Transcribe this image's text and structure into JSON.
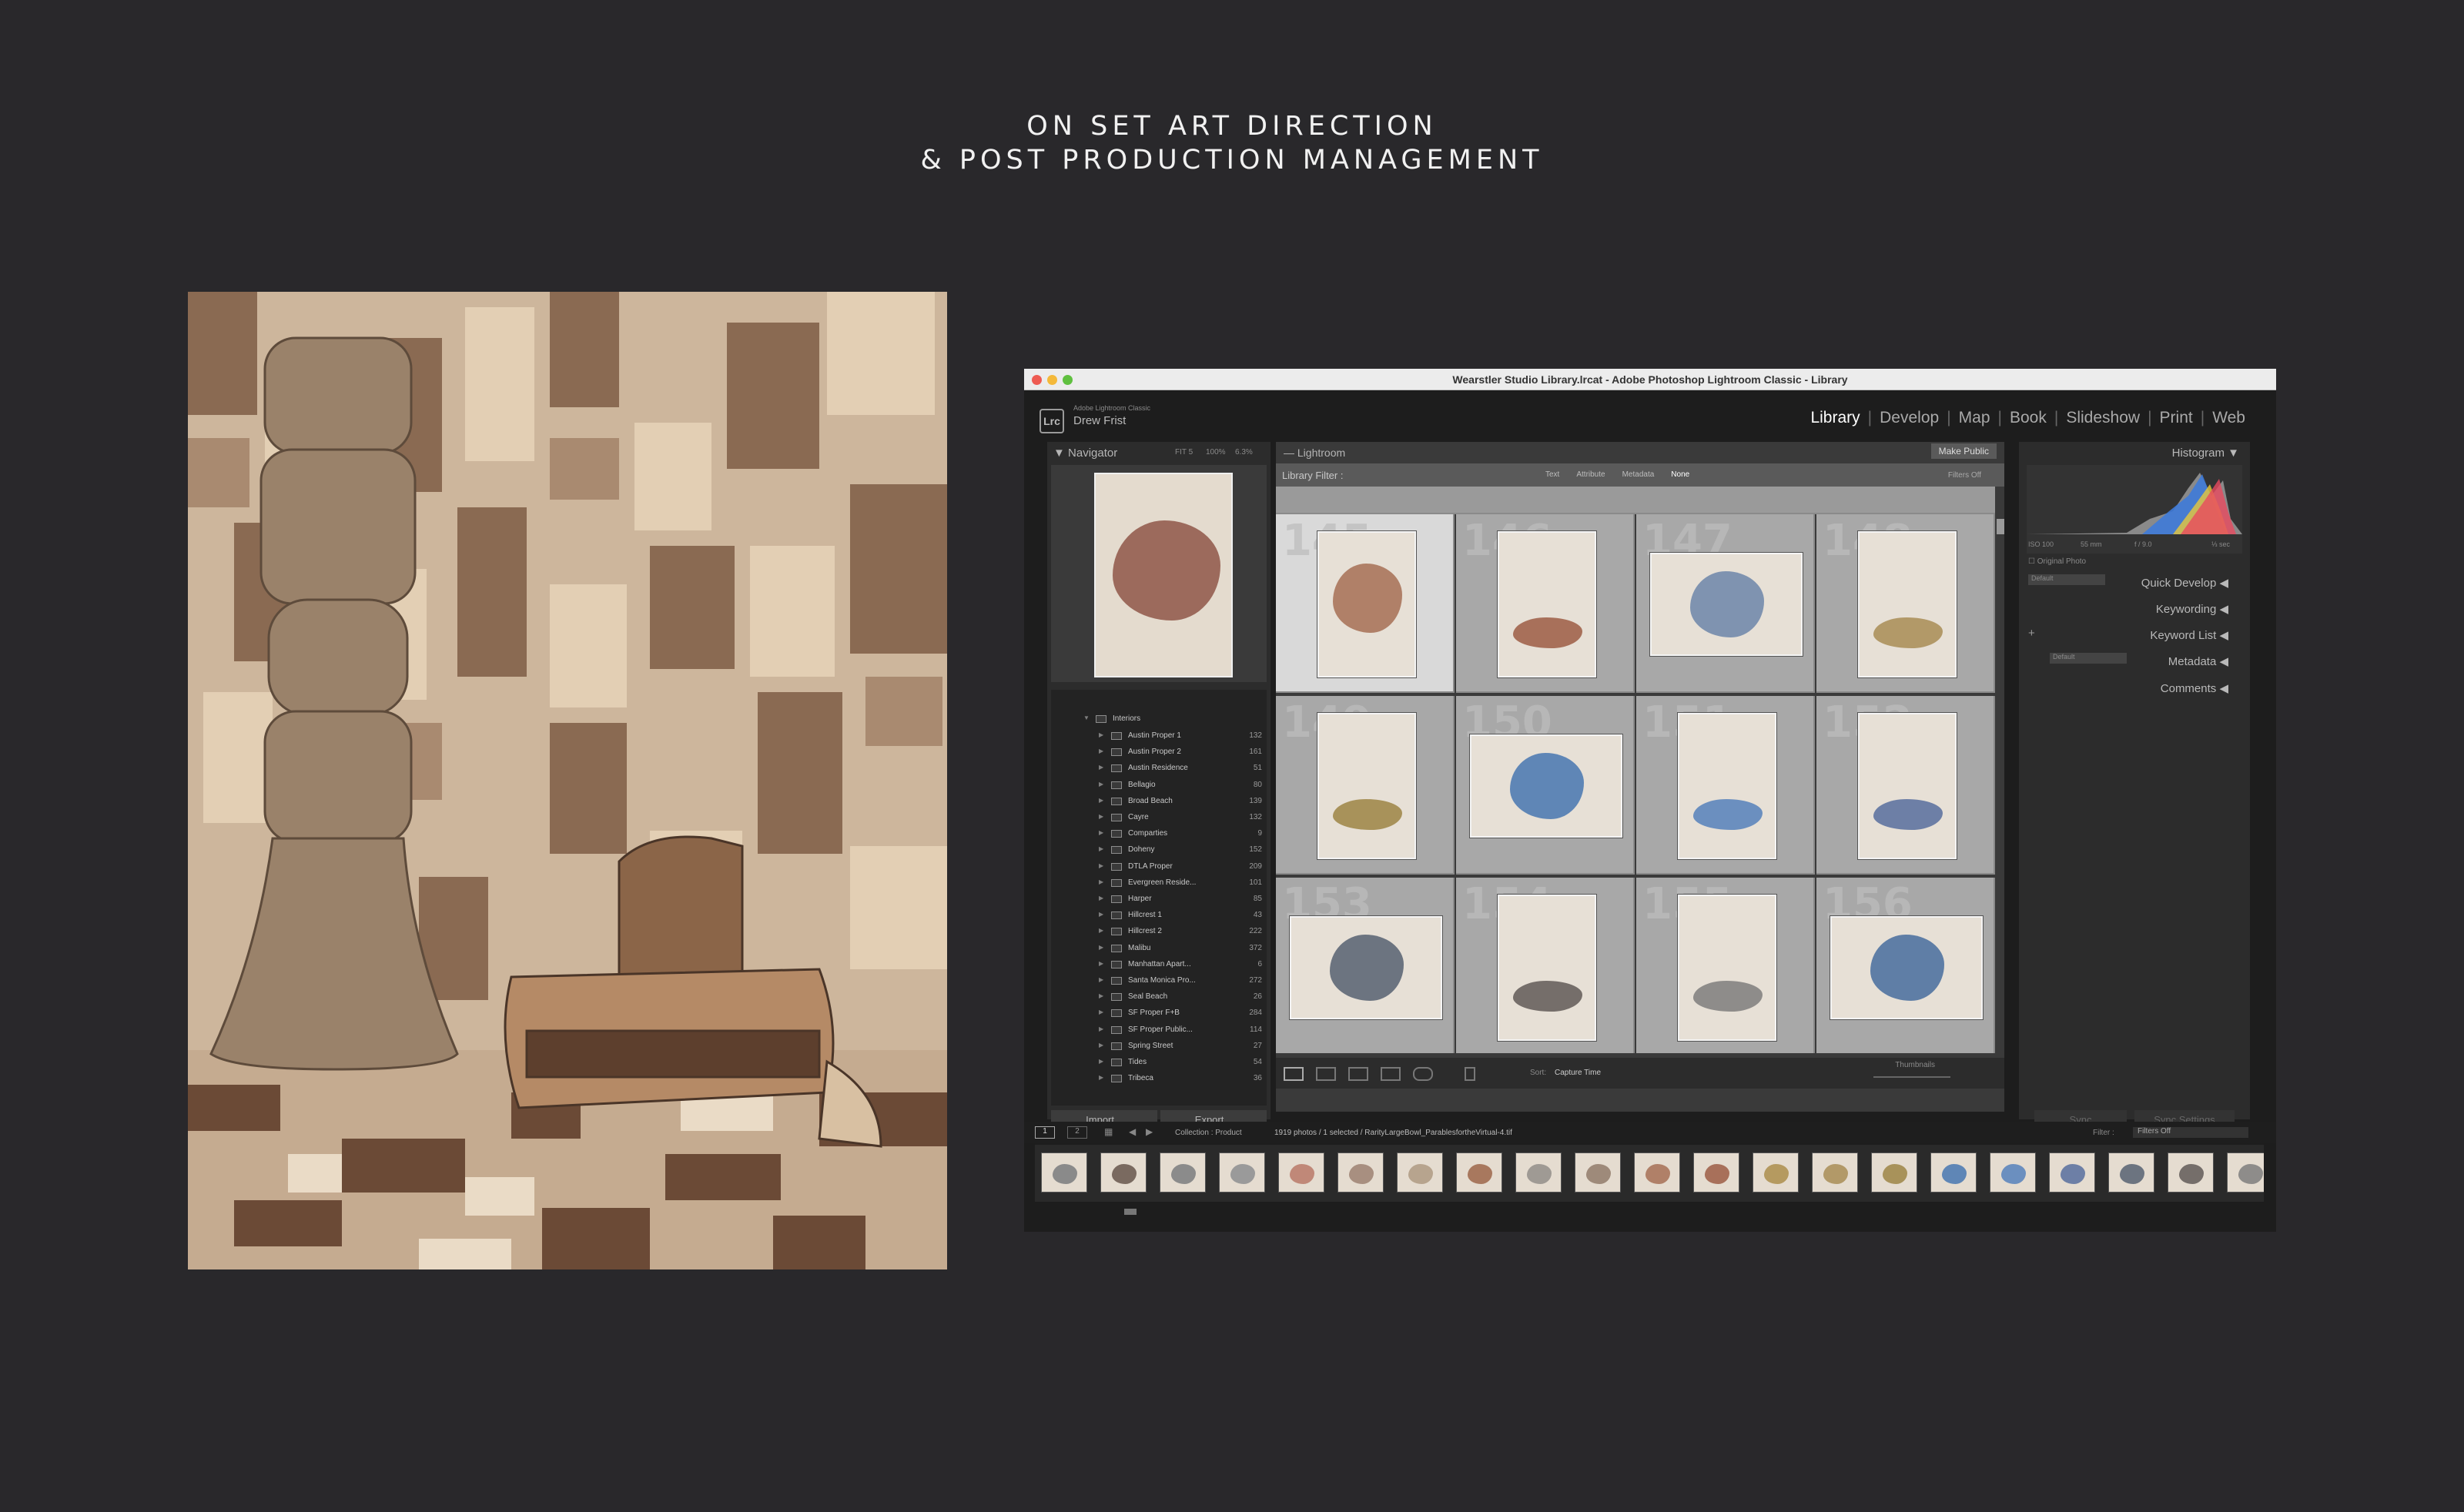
{
  "heading": {
    "line1": "ON SET ART DIRECTION",
    "line2": "& POST PRODUCTION MANAGEMENT"
  },
  "window": {
    "title": "Wearstler Studio Library.lrcat - Adobe Photoshop Lightroom Classic - Library"
  },
  "identity": {
    "logo": "Lrc",
    "app_small": "Adobe Lightroom Classic",
    "user": "Drew Frist"
  },
  "modules": [
    "Library",
    "Develop",
    "Map",
    "Book",
    "Slideshow",
    "Print",
    "Web"
  ],
  "active_module": "Library",
  "navigator": {
    "label": "Navigator",
    "zoom_fit": "FIT 5",
    "zoom_100": "100%",
    "zoom_ratio": "6.3%"
  },
  "collections": {
    "parent": "Interiors",
    "items": [
      {
        "name": "Austin Proper 1",
        "count": "132"
      },
      {
        "name": "Austin Proper 2",
        "count": "161"
      },
      {
        "name": "Austin Residence",
        "count": "51"
      },
      {
        "name": "Bellagio",
        "count": "80"
      },
      {
        "name": "Broad Beach",
        "count": "139"
      },
      {
        "name": "Cayre",
        "count": "132"
      },
      {
        "name": "Comparties",
        "count": "9"
      },
      {
        "name": "Doheny",
        "count": "152"
      },
      {
        "name": "DTLA Proper",
        "count": "209"
      },
      {
        "name": "Evergreen Reside...",
        "count": "101"
      },
      {
        "name": "Harper",
        "count": "85"
      },
      {
        "name": "Hillcrest 1",
        "count": "43"
      },
      {
        "name": "Hillcrest 2",
        "count": "222"
      },
      {
        "name": "Malibu",
        "count": "372"
      },
      {
        "name": "Manhattan Apart...",
        "count": "6"
      },
      {
        "name": "Santa Monica Pro...",
        "count": "272"
      },
      {
        "name": "Seal Beach",
        "count": "26"
      },
      {
        "name": "SF Proper F+B",
        "count": "284"
      },
      {
        "name": "SF Proper Public...",
        "count": "114"
      },
      {
        "name": "Spring Street",
        "count": "27"
      },
      {
        "name": "Tides",
        "count": "54"
      },
      {
        "name": "Tribeca",
        "count": "36"
      }
    ]
  },
  "left_buttons": {
    "import": "Import...",
    "export": "Export..."
  },
  "center": {
    "header": "Lightroom",
    "make_public": "Make Public",
    "filter_label": "Library Filter :",
    "filter_tabs": [
      "Text",
      "Attribute",
      "Metadata",
      "None"
    ],
    "filters_off": "Filters Off"
  },
  "grid": [
    {
      "num": "145",
      "selected": true,
      "shape": "portrait",
      "color": "#b08068"
    },
    {
      "num": "146",
      "selected": false,
      "shape": "portrait",
      "color": "#a8705a"
    },
    {
      "num": "147",
      "selected": false,
      "shape": "landscape",
      "color": "#7f93b0"
    },
    {
      "num": "148",
      "selected": false,
      "shape": "portrait",
      "color": "#b29968"
    },
    {
      "num": "149",
      "selected": false,
      "shape": "portrait",
      "color": "#a8925a"
    },
    {
      "num": "150",
      "selected": false,
      "shape": "landscape",
      "color": "#5f86b6"
    },
    {
      "num": "151",
      "selected": false,
      "shape": "portrait",
      "color": "#6b8fbf"
    },
    {
      "num": "152",
      "selected": false,
      "shape": "portrait",
      "color": "#6d7fa6"
    },
    {
      "num": "153",
      "selected": false,
      "shape": "landscape",
      "color": "#6c7480"
    },
    {
      "num": "154",
      "selected": false,
      "shape": "portrait",
      "color": "#756e6a"
    },
    {
      "num": "155",
      "selected": false,
      "shape": "portrait",
      "color": "#8e8c8a"
    },
    {
      "num": "156",
      "selected": false,
      "shape": "landscape",
      "color": "#5f7ea6"
    }
  ],
  "toolbar": {
    "sort_label": "Sort:",
    "sort_value": "Capture Time",
    "thumbnails_label": "Thumbnails"
  },
  "right": {
    "histogram": "Histogram",
    "iso": "ISO 100",
    "focal": "55 mm",
    "aperture": "f / 9.0",
    "shutter": "⅓ sec",
    "original_photo": "Original Photo",
    "preset": "Default",
    "quick_develop": "Quick Develop",
    "keywording": "Keywording",
    "keyword_list": "Keyword List",
    "metadata": "Metadata",
    "metadata_preset": "Default",
    "comments": "Comments",
    "sync": "Sync",
    "sync_settings": "Sync Settings"
  },
  "filmstrip": {
    "source": "Collection : Product",
    "info": "1919 photos / 1 selected / RarityLargeBowl_ParablesfortheVirtual-4.tif",
    "filter_label": "Filter :",
    "filter_value": "Filters Off",
    "view1": "1",
    "view2": "2"
  },
  "filmstrip_thumbs": [
    {
      "color": "#8a8a8a"
    },
    {
      "color": "#7a6a60"
    },
    {
      "color": "#8b8b8b"
    },
    {
      "color": "#9a9a9a"
    },
    {
      "color": "#c08878"
    },
    {
      "color": "#a88f80"
    },
    {
      "color": "#b7a48e"
    },
    {
      "color": "#a8785e"
    },
    {
      "color": "#9f9a94"
    },
    {
      "color": "#9e8a7a"
    },
    {
      "color": "#b08068"
    },
    {
      "color": "#a8705a"
    },
    {
      "color": "#b59a60"
    },
    {
      "color": "#b29968"
    },
    {
      "color": "#a8925a"
    },
    {
      "color": "#5f86b6"
    },
    {
      "color": "#6b8fbf"
    },
    {
      "color": "#6d7fa6"
    },
    {
      "color": "#6c7480"
    },
    {
      "color": "#756e6a"
    },
    {
      "color": "#8e8c8a"
    }
  ]
}
